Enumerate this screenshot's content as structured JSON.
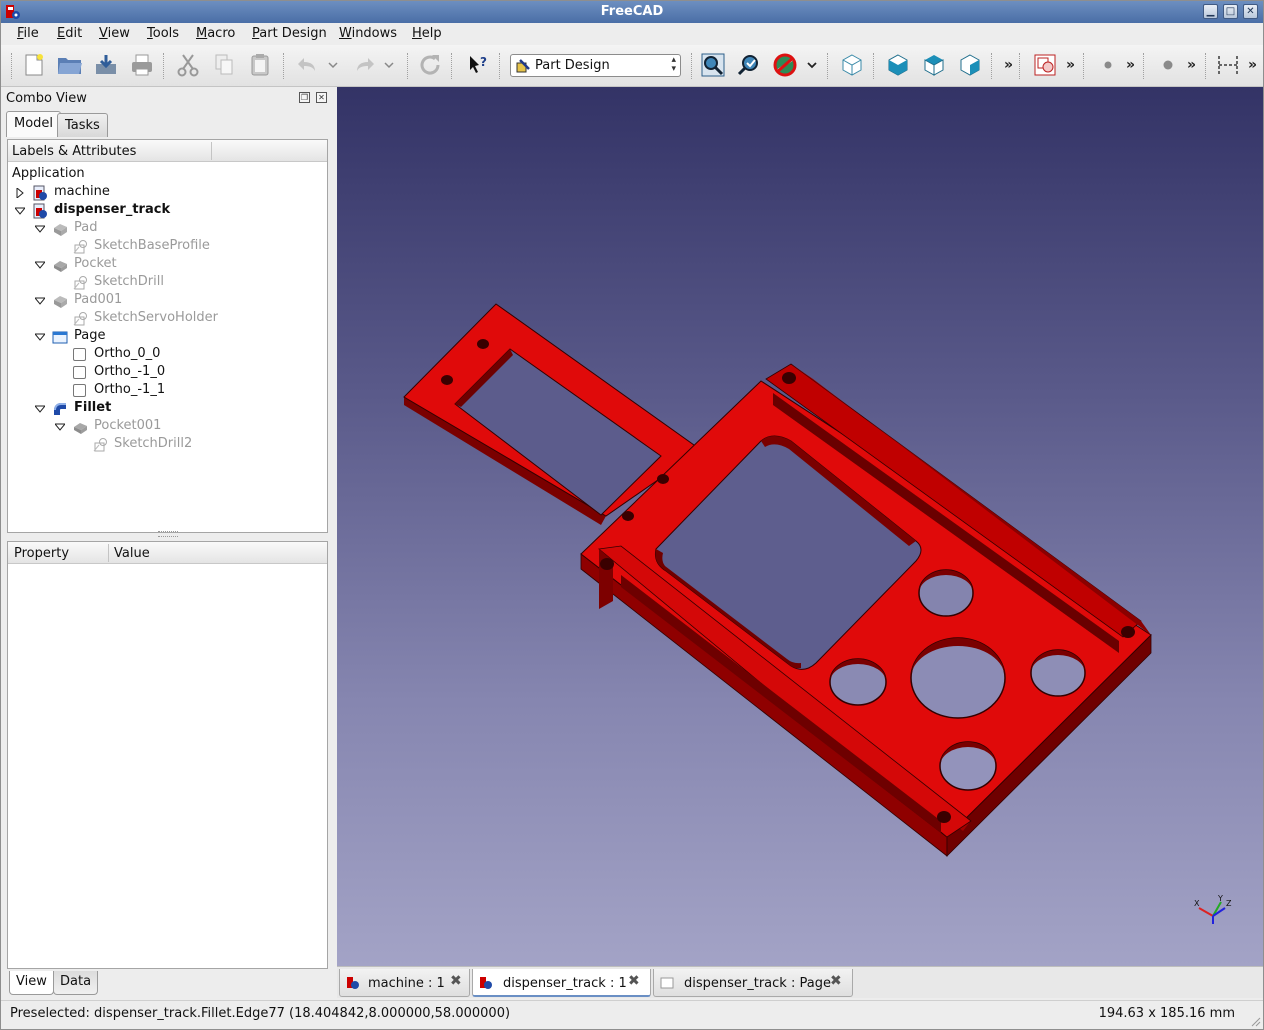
{
  "window": {
    "title": "FreeCAD"
  },
  "menu": [
    "File",
    "Edit",
    "View",
    "Tools",
    "Macro",
    "Part Design",
    "Windows",
    "Help"
  ],
  "toolbar": {
    "workbench": "Part Design",
    "more": "»",
    "icons": [
      "new-file-icon",
      "open-file-icon",
      "save-icon",
      "print-icon",
      "cut-icon",
      "copy-icon",
      "paste-icon",
      "undo-icon",
      "redo-icon",
      "refresh-icon",
      "whats-this-icon",
      "fit-all-icon",
      "fit-selection-icon",
      "draw-style-icon",
      "isometric-view-icon",
      "front-view-icon",
      "top-view-icon",
      "right-view-icon",
      "drawing-icon",
      "point-icon",
      "sketch-icon",
      "measure-icon"
    ]
  },
  "combo": {
    "title": "Combo View",
    "tabs": [
      "Model",
      "Tasks"
    ],
    "tree_header": "Labels & Attributes",
    "tree_root": "Application",
    "tree": [
      {
        "label": "machine",
        "depth": 0,
        "expander": "collapsed",
        "icon": "document-icon",
        "style": "normal"
      },
      {
        "label": "dispenser_track",
        "depth": 0,
        "expander": "expanded",
        "icon": "document-icon",
        "style": "bold"
      },
      {
        "label": "Pad",
        "depth": 1,
        "expander": "expanded",
        "icon": "pad-icon",
        "style": "dim"
      },
      {
        "label": "SketchBaseProfile",
        "depth": 2,
        "expander": "none",
        "icon": "sketch-icon",
        "style": "dim"
      },
      {
        "label": "Pocket",
        "depth": 1,
        "expander": "expanded",
        "icon": "pocket-icon",
        "style": "dim"
      },
      {
        "label": "SketchDrill",
        "depth": 2,
        "expander": "none",
        "icon": "sketch-icon",
        "style": "dim"
      },
      {
        "label": "Pad001",
        "depth": 1,
        "expander": "expanded",
        "icon": "pad-icon",
        "style": "dim"
      },
      {
        "label": "SketchServoHolder",
        "depth": 2,
        "expander": "none",
        "icon": "sketch-icon",
        "style": "dim"
      },
      {
        "label": "Page",
        "depth": 1,
        "expander": "expanded",
        "icon": "page-icon",
        "style": "normal"
      },
      {
        "label": "Ortho_0_0",
        "depth": 2,
        "expander": "none",
        "icon": "view-checkbox-icon",
        "style": "normal"
      },
      {
        "label": "Ortho_-1_0",
        "depth": 2,
        "expander": "none",
        "icon": "view-checkbox-icon",
        "style": "normal"
      },
      {
        "label": "Ortho_-1_1",
        "depth": 2,
        "expander": "none",
        "icon": "view-checkbox-icon",
        "style": "normal"
      },
      {
        "label": "Fillet",
        "depth": 1,
        "expander": "expanded",
        "icon": "fillet-icon",
        "style": "bold"
      },
      {
        "label": "Pocket001",
        "depth": 2,
        "expander": "expanded",
        "icon": "pocket-icon",
        "style": "dim"
      },
      {
        "label": "SketchDrill2",
        "depth": 3,
        "expander": "none",
        "icon": "sketch-icon",
        "style": "dim"
      }
    ],
    "property_header": {
      "property": "Property",
      "value": "Value"
    },
    "bottom_tabs": [
      "View",
      "Data"
    ]
  },
  "doc_tabs": [
    {
      "label": "machine : 1",
      "active": false,
      "icon": "freecad-doc-icon"
    },
    {
      "label": "dispenser_track : 1",
      "active": true,
      "icon": "freecad-doc-icon"
    },
    {
      "label": "dispenser_track : Page",
      "active": false,
      "icon": "page-doc-icon"
    }
  ],
  "axis": {
    "x": "X",
    "y": "Y",
    "z": "Z"
  },
  "status": {
    "message": "Preselected: dispenser_track.Fillet.Edge77 (18.404842,8.000000,58.000000)",
    "dimensions": "194.63 x 185.16 mm"
  },
  "colors": {
    "part": "#e00a0a",
    "part_dark": "#8a0000",
    "titlebar": "#4a6ea6"
  }
}
